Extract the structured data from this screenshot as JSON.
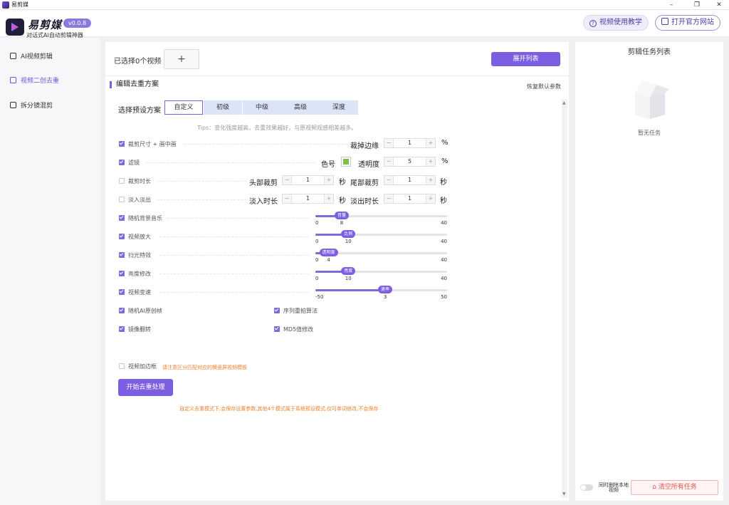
{
  "window": {
    "title": "易剪媒"
  },
  "header": {
    "app_name": "易剪媒",
    "version": "v0.0.8",
    "subtitle": "对话式AI自动剪辑神器",
    "tutorial_label": "视频使用教学",
    "official_label": "打开官方网站"
  },
  "sidebar": {
    "items": [
      {
        "label": "AI视频剪辑",
        "icon": "scissors-icon",
        "active": false
      },
      {
        "label": "视频二创去重",
        "icon": "video-icon",
        "active": true
      },
      {
        "label": "拆分镜混剪",
        "icon": "film-icon",
        "active": false
      }
    ]
  },
  "main": {
    "selected_text": "已选择0个视频",
    "add_symbol": "+",
    "expand_label": "展开列表",
    "section_title": "编辑去重方案",
    "reset_label": "恢复默认参数",
    "preset_label": "选择预设方案",
    "presets": [
      "自定义",
      "初级",
      "中级",
      "高级",
      "深度"
    ],
    "selected_preset": "自定义",
    "tips": "Tips：变化强度越高，去重效果越好，与原视频观感相差越多。"
  },
  "options": {
    "crop": {
      "label": "裁剪尺寸 + 画中画",
      "checked": true,
      "field_label": "裁掉边缘",
      "value": "1",
      "unit": "%"
    },
    "filter": {
      "label": "滤镜",
      "checked": true,
      "color_label": "色号",
      "color": "#7cc24a",
      "opacity_label": "透明度",
      "value": "5",
      "unit": "%"
    },
    "trim": {
      "label": "裁剪时长",
      "checked": false,
      "head_label": "头部裁剪",
      "head_value": "1",
      "head_unit": "秒",
      "tail_label": "尾部裁剪",
      "tail_value": "1",
      "tail_unit": "秒"
    },
    "fade": {
      "label": "淡入淡出",
      "checked": false,
      "in_label": "淡入时长",
      "in_value": "1",
      "in_unit": "秒",
      "out_label": "淡出时长",
      "out_value": "1",
      "out_unit": "秒"
    },
    "bgm": {
      "label": "随机背景音乐",
      "checked": true,
      "handle_label": "音量",
      "min": "0",
      "max": "40",
      "value": 8,
      "value_label": "8"
    },
    "zoom": {
      "label": "视频放大",
      "checked": true,
      "handle_label": "比例",
      "min": "0",
      "max": "40",
      "value": 10,
      "value_label": "10"
    },
    "sweep": {
      "label": "扫光特效",
      "checked": true,
      "handle_label": "透明度",
      "min": "0",
      "max": "40",
      "value": 4,
      "value_label": "4"
    },
    "brightness": {
      "label": "亮度修改",
      "checked": true,
      "handle_label": "亮度",
      "min": "0",
      "max": "40",
      "value": 10,
      "value_label": "10"
    },
    "speed": {
      "label": "视频变速",
      "checked": true,
      "handle_label": "速率",
      "min": "-50",
      "max": "50",
      "value": 3,
      "value_label": "3"
    },
    "ai_frame": {
      "label": "随机AI原创帧",
      "checked": true
    },
    "resample": {
      "label": "序列重拍算法",
      "checked": true
    },
    "mirror": {
      "label": "镜像翻转",
      "checked": true
    },
    "md5": {
      "label": "MD5值修改",
      "checked": true
    },
    "border": {
      "label": "视频加边框",
      "checked": false,
      "note": "请注意区分匹配对应的横竖屏视频模板"
    }
  },
  "actions": {
    "start_label": "开始去重处理",
    "bottom_note": "自定义去重模式下,会保存设置参数,其他4个模式属于系统预设模式,仅可单词修改,不会保存"
  },
  "right_panel": {
    "title": "剪辑任务列表",
    "empty_text": "暂无任务",
    "sync_label": "同时删除本地视频",
    "sync_enabled": false,
    "clear_label": "清空所有任务"
  },
  "colors": {
    "accent": "#7c5fe0",
    "warning": "#f0812f",
    "danger": "#e05252"
  }
}
